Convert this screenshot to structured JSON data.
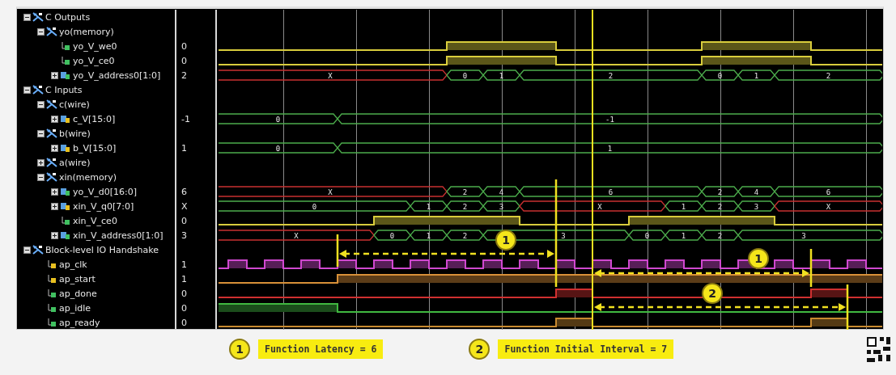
{
  "signals": [
    {
      "label": "C Outputs",
      "kind": "group",
      "expanded": true,
      "children": [
        {
          "label": "yo(memory)",
          "kind": "group",
          "expanded": true,
          "children": [
            {
              "label": "yo_V_we0",
              "kind": "bit",
              "is_input": false,
              "value": "0",
              "color": "#d8cc3c"
            },
            {
              "label": "yo_V_ce0",
              "kind": "bit",
              "is_input": false,
              "value": "0",
              "color": "#d8cc3c"
            },
            {
              "label": "yo_V_address0[1:0]",
              "kind": "bus",
              "is_input": false,
              "expanded": false,
              "value": "2",
              "values": [
                {
                  "value": "X",
                  "unknown": true
                },
                {
                  "value": "0",
                  "unknown": false
                },
                {
                  "value": "1",
                  "unknown": false
                },
                {
                  "value": "2",
                  "unknown": false
                },
                {
                  "value": "0",
                  "unknown": false
                },
                {
                  "value": "1",
                  "unknown": false
                },
                {
                  "value": "2",
                  "unknown": false
                }
              ]
            }
          ]
        }
      ]
    },
    {
      "label": "C Inputs",
      "kind": "group",
      "expanded": true,
      "children": [
        {
          "label": "c(wire)",
          "kind": "group",
          "expanded": true,
          "children": [
            {
              "label": "c_V[15:0]",
              "kind": "bus",
              "is_input": true,
              "expanded": false,
              "value": "-1",
              "values": [
                {
                  "value": "0",
                  "unknown": false
                },
                {
                  "value": "-1",
                  "unknown": false
                }
              ]
            }
          ]
        },
        {
          "label": "b(wire)",
          "kind": "group",
          "expanded": true,
          "children": [
            {
              "label": "b_V[15:0]",
              "kind": "bus",
              "is_input": true,
              "expanded": false,
              "value": "1",
              "values": [
                {
                  "value": "0",
                  "unknown": false
                },
                {
                  "value": "1",
                  "unknown": false
                }
              ]
            }
          ]
        },
        {
          "label": "a(wire)",
          "kind": "group",
          "expanded": false
        },
        {
          "label": "xin(memory)",
          "kind": "group",
          "expanded": true,
          "children": [
            {
              "label": "yo_V_d0[16:0]",
              "kind": "bus",
              "is_input": false,
              "expanded": false,
              "value": "6",
              "values": [
                {
                  "value": "X",
                  "unknown": true
                },
                {
                  "value": "2",
                  "unknown": false
                },
                {
                  "value": "4",
                  "unknown": false
                },
                {
                  "value": "6",
                  "unknown": false
                },
                {
                  "value": "2",
                  "unknown": false
                },
                {
                  "value": "4",
                  "unknown": false
                },
                {
                  "value": "6",
                  "unknown": false
                }
              ]
            },
            {
              "label": "xin_V_q0[7:0]",
              "kind": "bus",
              "is_input": true,
              "expanded": false,
              "value": "X",
              "values": [
                {
                  "value": "0",
                  "unknown": false
                },
                {
                  "value": "1",
                  "unknown": false
                },
                {
                  "value": "2",
                  "unknown": false
                },
                {
                  "value": "3",
                  "unknown": false
                },
                {
                  "value": "X",
                  "unknown": true
                },
                {
                  "value": "1",
                  "unknown": false
                },
                {
                  "value": "2",
                  "unknown": false
                },
                {
                  "value": "3",
                  "unknown": false
                },
                {
                  "value": "X",
                  "unknown": true
                }
              ]
            },
            {
              "label": "xin_V_ce0",
              "kind": "bit",
              "is_input": false,
              "value": "0",
              "color": "#d8cc3c"
            },
            {
              "label": "xin_V_address0[1:0]",
              "kind": "bus",
              "is_input": false,
              "expanded": false,
              "value": "3",
              "values": [
                {
                  "value": "X",
                  "unknown": true
                },
                {
                  "value": "0",
                  "unknown": false
                },
                {
                  "value": "1",
                  "unknown": false
                },
                {
                  "value": "2",
                  "unknown": false
                },
                {
                  "value": "3",
                  "unknown": false
                },
                {
                  "value": "0",
                  "unknown": false
                },
                {
                  "value": "1",
                  "unknown": false
                },
                {
                  "value": "2",
                  "unknown": false
                },
                {
                  "value": "3",
                  "unknown": false
                }
              ]
            }
          ]
        }
      ]
    },
    {
      "label": "Block-level IO Handshake",
      "kind": "group",
      "expanded": true,
      "children": [
        {
          "label": "ap_clk",
          "kind": "clock",
          "is_input": true,
          "value": "1",
          "color": "#d048d0"
        },
        {
          "label": "ap_start",
          "kind": "bit",
          "is_input": true,
          "value": "1",
          "color": "#d89038"
        },
        {
          "label": "ap_done",
          "kind": "bit",
          "is_input": false,
          "value": "0",
          "color": "#d03030"
        },
        {
          "label": "ap_idle",
          "kind": "bit",
          "is_input": false,
          "value": "0",
          "color": "#40b840"
        },
        {
          "label": "ap_ready",
          "kind": "bit",
          "is_input": false,
          "value": "0",
          "color": "#c88a30"
        }
      ]
    }
  ],
  "annotations": [
    {
      "label": "1"
    },
    {
      "label": "1"
    },
    {
      "label": "2"
    }
  ],
  "legend": [
    {
      "badge": "1",
      "text": "Function Latency = 6"
    },
    {
      "badge": "2",
      "text": "Function Initial Interval = 7"
    }
  ]
}
